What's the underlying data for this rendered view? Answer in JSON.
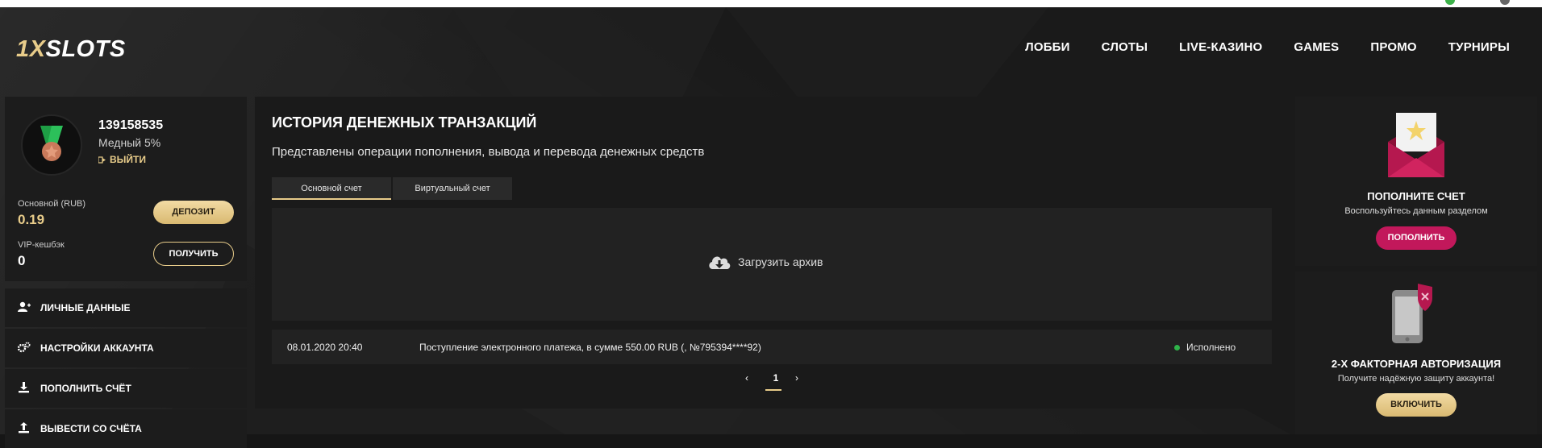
{
  "brand": {
    "logo_prefix": "1X",
    "logo_suffix": "SLOTS",
    "accent": "#e8cc8a",
    "pink": "#c2185b",
    "success": "#2fb34a"
  },
  "nav": [
    {
      "label": "ЛОББИ"
    },
    {
      "label": "СЛОТЫ"
    },
    {
      "label": "LIVE-КАЗИНО"
    },
    {
      "label": "GAMES"
    },
    {
      "label": "ПРОМО"
    },
    {
      "label": "ТУРНИРЫ"
    }
  ],
  "profile": {
    "avatar_icon": "copper-medal-icon",
    "user_id": "139158535",
    "rank": "Медный 5%",
    "logout_label": "ВЫЙТИ",
    "balance_label": "Основной (RUB)",
    "balance_value": "0.19",
    "deposit_label": "ДЕПОЗИТ",
    "cashback_label": "VIP-кешбэк",
    "cashback_value": "0",
    "claim_label": "ПОЛУЧИТЬ"
  },
  "menu": [
    {
      "label": "ЛИЧНЫЕ ДАННЫЕ",
      "icon": "user-plus-icon"
    },
    {
      "label": "НАСТРОЙКИ АККАУНТА",
      "icon": "gears-icon"
    },
    {
      "label": "ПОПОЛНИТЬ СЧЁТ",
      "icon": "download-icon"
    },
    {
      "label": "ВЫВЕСТИ СО СЧЁТА",
      "icon": "upload-icon"
    }
  ],
  "main": {
    "title": "ИСТОРИЯ ДЕНЕЖНЫХ ТРАНЗАКЦИЙ",
    "subtitle": "Представлены операции пополнения, вывода и перевода денежных средств",
    "tabs": [
      {
        "label": "Основной счет",
        "active": true
      },
      {
        "label": "Виртуальный счет",
        "active": false
      }
    ],
    "archive_label": "Загрузить архив",
    "transactions": [
      {
        "datetime": "08.01.2020 20:40",
        "description": "Поступление электронного платежа, в сумме 550.00 RUB (, №795394****92)",
        "status": "Исполнено"
      }
    ],
    "pagination": {
      "prev": "‹",
      "current": "1",
      "next": "›"
    }
  },
  "cards": {
    "deposit": {
      "title": "ПОПОЛНИТЕ СЧЕТ",
      "subtitle": "Воспользуйтесь данным разделом",
      "button": "ПОПОЛНИТЬ",
      "icon": "envelope-star-icon"
    },
    "twofa": {
      "title": "2-Х ФАКТОРНАЯ АВТОРИЗАЦИЯ",
      "subtitle": "Получите надёжную защиту аккаунта!",
      "button": "ВКЛЮЧИТЬ",
      "icon": "phone-shield-icon"
    }
  }
}
